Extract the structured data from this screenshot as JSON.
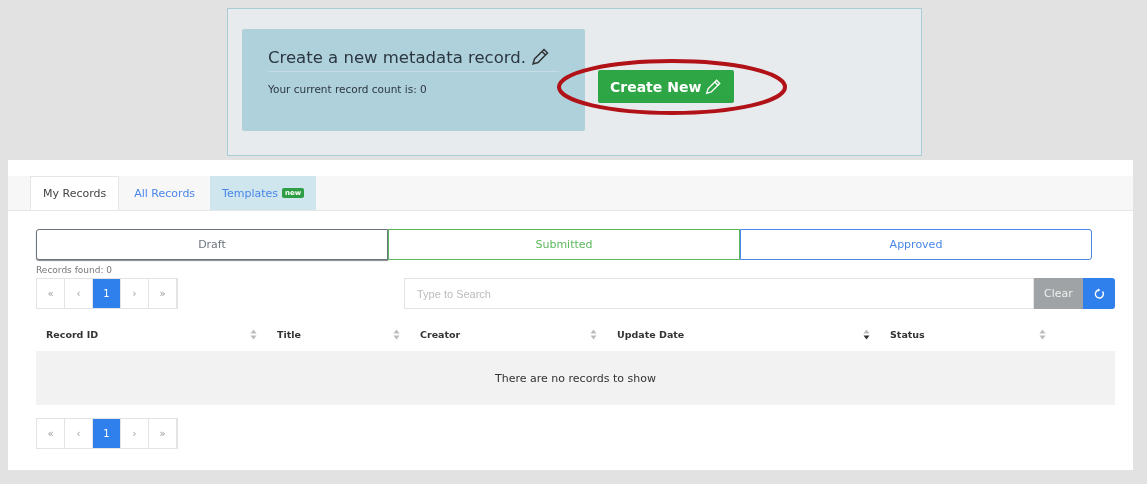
{
  "intro": {
    "title": "Create a new metadata record.",
    "count_text": "Your current record count is: 0",
    "button": "Create New",
    "button_circled": true
  },
  "tabs": [
    {
      "label": "My Records",
      "selected": true,
      "highlighted": false
    },
    {
      "label": "All Records",
      "selected": false,
      "highlighted": false
    },
    {
      "label": "Templates",
      "selected": false,
      "highlighted": true,
      "badge": "new"
    }
  ],
  "status_filters": [
    {
      "label": "Draft",
      "color": "#6c757d"
    },
    {
      "label": "Submitted",
      "color": "#5cb85c"
    },
    {
      "label": "Approved",
      "color": "#4a86e8"
    }
  ],
  "records_found": "Records found: 0",
  "pagination_top": [
    {
      "label": "«",
      "selected": false
    },
    {
      "label": "‹",
      "selected": false
    },
    {
      "label": "1",
      "selected": true
    },
    {
      "label": "›",
      "selected": false
    },
    {
      "label": "»",
      "selected": false
    }
  ],
  "search": {
    "placeholder": "Type to Search",
    "clear": "Clear"
  },
  "table": {
    "columns": [
      {
        "label": "Record ID",
        "sorted_desc": false
      },
      {
        "label": "Title",
        "sorted_desc": false
      },
      {
        "label": "Creator",
        "sorted_desc": false
      },
      {
        "label": "Update Date",
        "sorted_desc": true
      },
      {
        "label": "Status",
        "sorted_desc": false
      }
    ],
    "empty_text": "There are no records to show"
  },
  "pagination_bottom": [
    {
      "label": "«",
      "selected": false
    },
    {
      "label": "‹",
      "selected": false
    },
    {
      "label": "1",
      "selected": true
    },
    {
      "label": "›",
      "selected": false
    },
    {
      "label": "»",
      "selected": false
    }
  ]
}
